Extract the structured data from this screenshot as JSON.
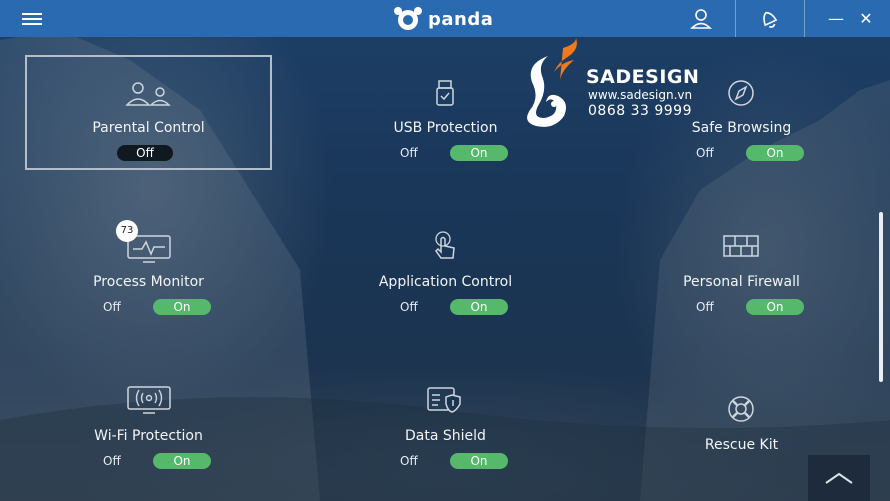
{
  "app": {
    "logo_text": "panda",
    "icons": {
      "menu": "hamburger-icon",
      "user": "user-icon",
      "notifications": "bell-icon",
      "minimize": "minimize-icon",
      "close": "close-icon"
    },
    "minimize_glyph": "—",
    "close_glyph": "✕",
    "accent_color": "#2a6ab0",
    "on_color": "#55b86a"
  },
  "tiles": [
    {
      "title": "Parental Control",
      "state": "Off",
      "icon": "parental-icon",
      "selected": true
    },
    {
      "title": "USB Protection",
      "off_label": "Off",
      "on_label": "On",
      "icon": "usb-icon"
    },
    {
      "title": "Safe Browsing",
      "off_label": "Off",
      "on_label": "On",
      "icon": "compass-icon"
    },
    {
      "title": "Process Monitor",
      "off_label": "Off",
      "on_label": "On",
      "icon": "monitor-icon",
      "badge": "73"
    },
    {
      "title": "Application Control",
      "off_label": "Off",
      "on_label": "On",
      "icon": "hand-touch-icon"
    },
    {
      "title": "Personal Firewall",
      "off_label": "Off",
      "on_label": "On",
      "icon": "firewall-icon"
    },
    {
      "title": "Wi-Fi Protection",
      "off_label": "Off",
      "on_label": "On",
      "icon": "wifi-monitor-icon"
    },
    {
      "title": "Data Shield",
      "off_label": "Off",
      "on_label": "On",
      "icon": "data-shield-icon"
    },
    {
      "title": "Rescue Kit",
      "icon": "lifebuoy-icon"
    }
  ],
  "watermark": {
    "brand": "SADESIGN",
    "url": "www.sadesign.vn",
    "phone": "0868 33 9999"
  },
  "scroll_top_icon": "chevron-up-icon"
}
